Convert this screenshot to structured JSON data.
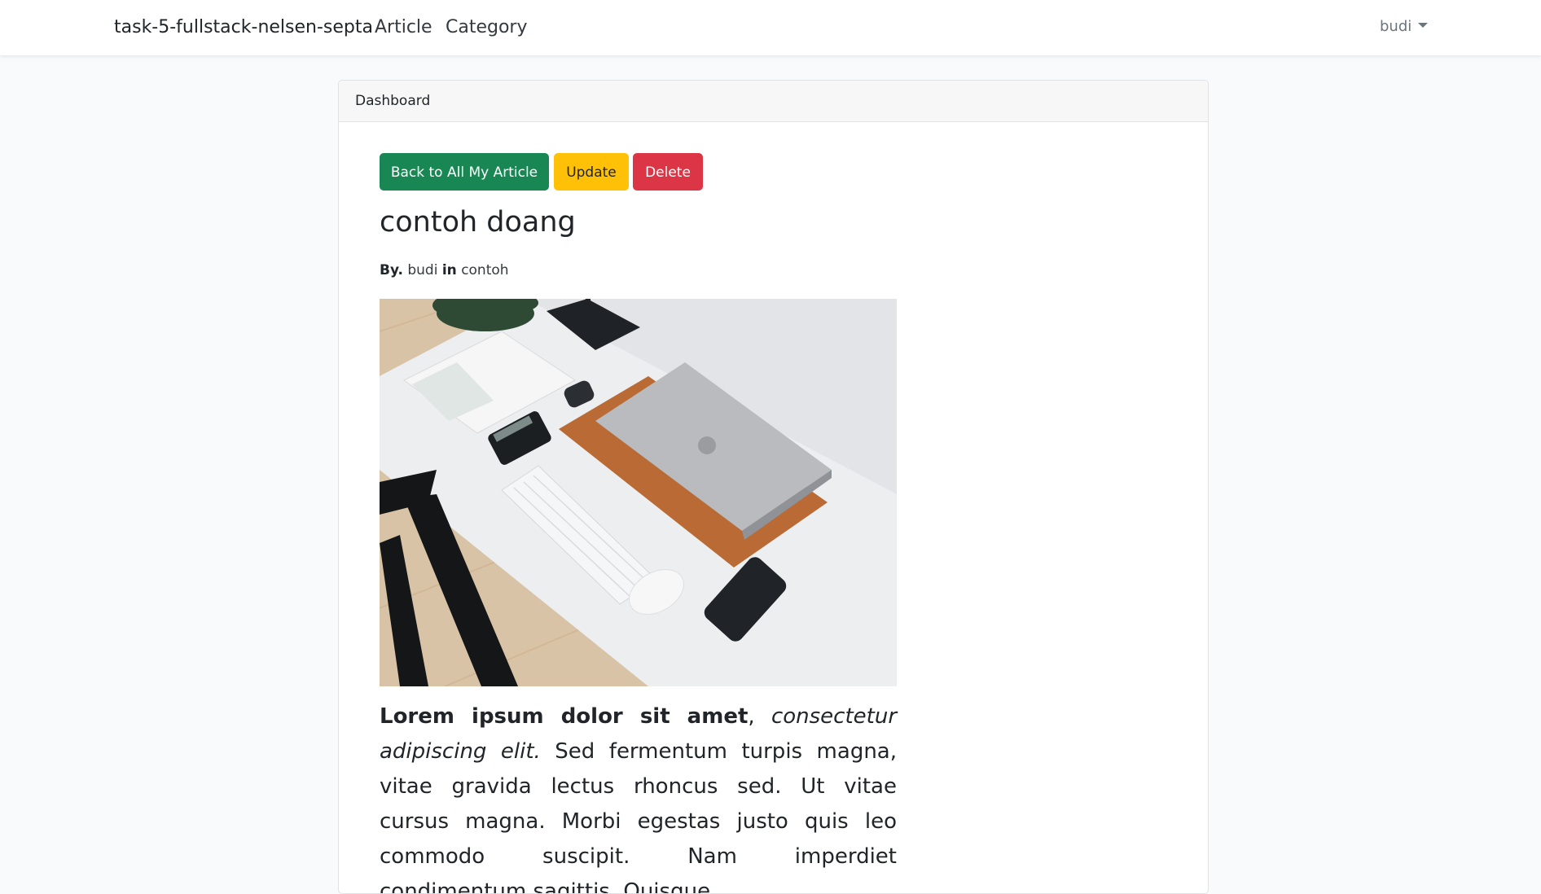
{
  "navbar": {
    "brand": "task-5-fullstack-nelsen-septa",
    "links": [
      "Article",
      "Category"
    ],
    "user": "budi"
  },
  "card": {
    "header": "Dashboard"
  },
  "actions": {
    "back_label": "Back to All My Article",
    "update_label": "Update",
    "delete_label": "Delete"
  },
  "article": {
    "title": "contoh doang",
    "by_label": "By.",
    "author": "budi",
    "in_label": "in",
    "category": "contoh",
    "image_icon": "desk-photo",
    "body_bold": "Lorem ipsum dolor sit amet",
    "body_sep": ", ",
    "body_italic": "consectetur adipiscing elit.",
    "body_rest": " Sed fermentum turpis magna, vitae gravida lectus rhoncus sed. Ut vitae cursus magna. Morbi egestas justo quis leo commodo suscipit. Nam imperdiet condimentum sagittis. Quisque"
  },
  "colors": {
    "success": "#198754",
    "warning": "#ffc107",
    "danger": "#dc3545",
    "page_bg": "#f8fafc"
  }
}
